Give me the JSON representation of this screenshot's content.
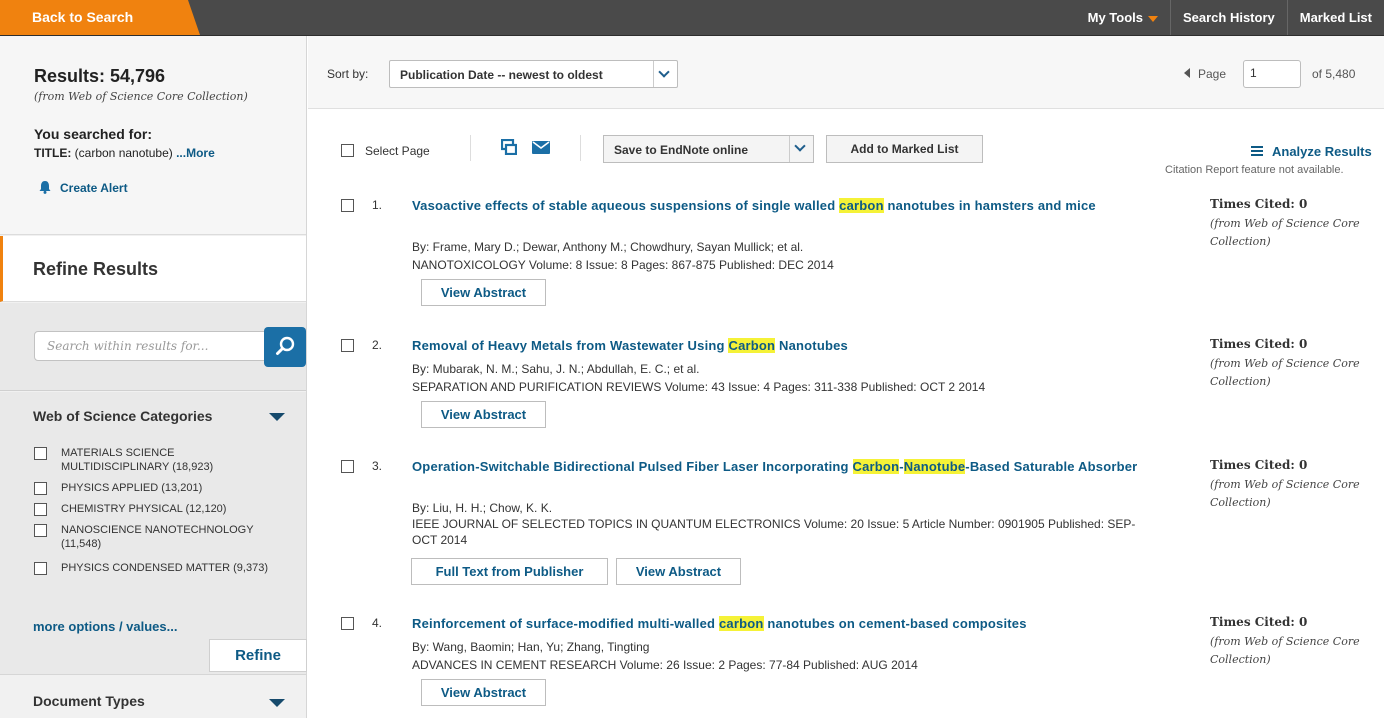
{
  "topbar": {
    "back_label": "Back to Search",
    "nav": [
      "My Tools",
      "Search History",
      "Marked List"
    ]
  },
  "sidebar": {
    "results_label": "Results: 54,796",
    "results_from": "(from Web of Science Core Collection)",
    "searched_label": "You searched for:",
    "query_field": "TITLE:",
    "query_value": "(carbon nanotube)",
    "more_label": "...More",
    "create_alert": "Create Alert",
    "refine_title": "Refine Results",
    "search_placeholder": "Search within results for...",
    "categories_title": "Web of Science Categories",
    "categories": [
      "MATERIALS SCIENCE MULTIDISCIPLINARY (18,923)",
      "PHYSICS APPLIED (13,201)",
      "CHEMISTRY PHYSICAL (12,120)",
      "NANOSCIENCE NANOTECHNOLOGY (11,548)",
      "PHYSICS CONDENSED MATTER (9,373)"
    ],
    "more_options": "more options / values...",
    "refine_button": "Refine",
    "doc_types_title": "Document Types"
  },
  "main": {
    "sort_label": "Sort by:",
    "sort_value": "Publication Date -- newest to oldest",
    "page_label": "Page",
    "page_value": "1",
    "page_total": "of  5,480",
    "select_page": "Select Page",
    "endnote_label": "Save to EndNote online",
    "marked_list_button": "Add to Marked List",
    "analyze_label": "Analyze Results",
    "citation_note": "Citation Report feature not available.",
    "view_abstract": "View Abstract",
    "full_text": "Full Text from Publisher",
    "times_cited_label": "Times Cited: 0",
    "times_cited_from": "(from Web of Science Core Collection)"
  },
  "records": [
    {
      "num": "1.",
      "title_parts": [
        "Vasoactive effects of stable aqueous suspensions of single walled ",
        "carbon",
        " nanotubes in hamsters and mice"
      ],
      "authors": "By: Frame, Mary D.; Dewar, Anthony M.; Chowdhury, Sayan Mullick; et al.",
      "source": "NANOTOXICOLOGY  Volume: 8   Issue: 8   Pages: 867-875   Published: DEC 2014"
    },
    {
      "num": "2.",
      "title_parts": [
        "Removal of Heavy Metals from Wastewater Using ",
        "Carbon",
        " Nanotubes"
      ],
      "authors": "By: Mubarak, N. M.; Sahu, J. N.; Abdullah, E. C.; et al.",
      "source": "SEPARATION AND PURIFICATION REVIEWS  Volume: 43   Issue: 4   Pages: 311-338   Published: OCT 2 2014"
    },
    {
      "num": "3.",
      "title_parts": [
        "Operation-Switchable Bidirectional Pulsed Fiber Laser Incorporating ",
        "Carbon",
        "-",
        "Nanotube",
        "-Based Saturable Absorber"
      ],
      "authors": "By: Liu, H. H.; Chow, K. K.",
      "source": "IEEE JOURNAL OF SELECTED TOPICS IN QUANTUM ELECTRONICS  Volume: 20   Issue: 5      Article Number: 0901905   Published: SEP-OCT 2014"
    },
    {
      "num": "4.",
      "title_parts": [
        "Reinforcement of surface-modified multi-walled ",
        "carbon",
        " nanotubes on cement-based composites"
      ],
      "authors": "By: Wang, Baomin; Han, Yu; Zhang, Tingting",
      "source": "ADVANCES IN CEMENT RESEARCH  Volume: 26   Issue: 2   Pages: 77-84   Published: AUG 2014"
    }
  ],
  "colors": {
    "accent": "#f0820f",
    "link": "#0d5a85",
    "highlight": "#f5f237",
    "topbar": "#4a4a4a"
  }
}
